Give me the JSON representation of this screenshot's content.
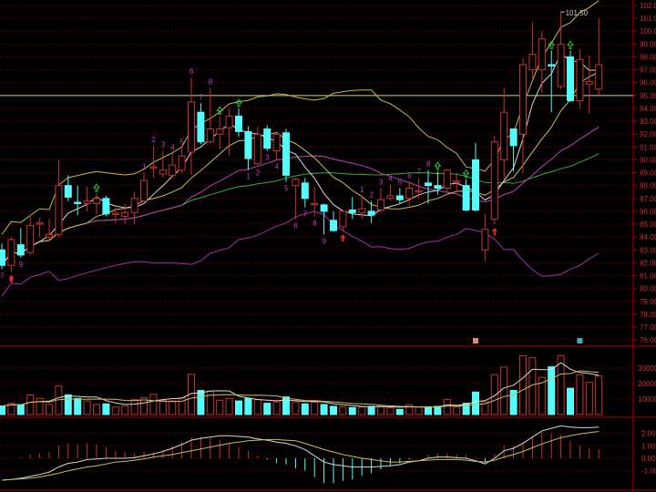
{
  "chart_data": {
    "type": "candlestick",
    "price_axis": {
      "ylim": [
        75.5,
        102.4
      ],
      "ticks": [
        "102.0",
        "101.0",
        "100.0",
        "99.00",
        "98.00",
        "97.00",
        "96.00",
        "95.00",
        "94.00",
        "93.00",
        "92.00",
        "91.00",
        "90.00",
        "89.00",
        "88.00",
        "87.00",
        "86.00",
        "85.00",
        "84.00",
        "83.00",
        "82.00",
        "81.00",
        "80.00",
        "79.00",
        "78.00",
        "77.00",
        "76.00"
      ]
    },
    "volume_axis": {
      "ylim": [
        0,
        45000
      ],
      "ticks": [
        "30000",
        "20000",
        "10000"
      ]
    },
    "macd_axis": {
      "ylim": [
        -3.7,
        3.3
      ],
      "ticks": [
        "2.00",
        "1.00",
        "0.00",
        "-1.00"
      ]
    },
    "reference_line": 95.0,
    "high_label": "101.50",
    "candles": [
      [
        83.0,
        83.5,
        81.5,
        81.8
      ],
      [
        81.8,
        84.0,
        81.3,
        83.8
      ],
      [
        83.4,
        84.7,
        82.4,
        82.6
      ],
      [
        82.8,
        85.7,
        82.6,
        84.9
      ],
      [
        85.0,
        85.5,
        84.0,
        85.1
      ],
      [
        84.0,
        85.4,
        83.8,
        84.2
      ],
      [
        84.2,
        90.0,
        84.0,
        88.0
      ],
      [
        88.0,
        88.8,
        86.8,
        87.1
      ],
      [
        86.7,
        88.0,
        85.7,
        86.6
      ],
      [
        86.6,
        87.9,
        86.0,
        86.8
      ],
      [
        86.6,
        87.4,
        85.8,
        87.0
      ],
      [
        87.0,
        87.2,
        85.6,
        85.8
      ],
      [
        85.75,
        86.3,
        85.1,
        85.85
      ],
      [
        85.6,
        86.6,
        85.0,
        85.9
      ],
      [
        85.9,
        87.5,
        85.0,
        87.0
      ],
      [
        86.8,
        89.0,
        86.6,
        88.4
      ],
      [
        89.35,
        91.1,
        88.6,
        89.45
      ],
      [
        88.9,
        90.7,
        88.6,
        89.2
      ],
      [
        88.8,
        90.5,
        88.6,
        89.6
      ],
      [
        89.2,
        90.9,
        89.0,
        90.3
      ],
      [
        90.6,
        96.4,
        88.8,
        94.5
      ],
      [
        93.7,
        94.4,
        91.2,
        91.4
      ],
      [
        91.4,
        95.6,
        91.2,
        92.4
      ],
      [
        92.0,
        93.4,
        90.8,
        92.4
      ],
      [
        92.5,
        94.0,
        90.3,
        93.4
      ],
      [
        93.4,
        94.0,
        91.8,
        92.2
      ],
      [
        92.2,
        92.6,
        89.2,
        90.1
      ],
      [
        89.7,
        92.6,
        89.5,
        92.0
      ],
      [
        92.4,
        92.7,
        90.7,
        90.9
      ],
      [
        90.7,
        92.2,
        90.0,
        92.0
      ],
      [
        92.1,
        92.4,
        88.3,
        88.8
      ],
      [
        88.0,
        88.6,
        85.4,
        88.5
      ],
      [
        88.2,
        88.6,
        86.3,
        87.0
      ],
      [
        86.5,
        87.9,
        85.6,
        86.6
      ],
      [
        86.5,
        86.6,
        84.2,
        86.0
      ],
      [
        85.3,
        86.0,
        84.4,
        84.5
      ],
      [
        84.8,
        86.1,
        84.5,
        86.0
      ],
      [
        86.1,
        87.1,
        85.4,
        85.9
      ],
      [
        85.9,
        87.2,
        85.4,
        86.2
      ],
      [
        86.0,
        86.8,
        85.1,
        85.7
      ],
      [
        86.1,
        87.8,
        85.9,
        86.9
      ],
      [
        87.0,
        88.1,
        86.8,
        87.2
      ],
      [
        87.2,
        87.8,
        86.6,
        86.9
      ],
      [
        87.0,
        88.3,
        86.4,
        87.8
      ],
      [
        87.5,
        88.6,
        87.0,
        87.6
      ],
      [
        88.2,
        89.2,
        86.6,
        88.0
      ],
      [
        88.0,
        89.1,
        87.3,
        87.8
      ],
      [
        87.8,
        89.3,
        87.5,
        89.2
      ],
      [
        88.25,
        89.0,
        87.5,
        88.35
      ],
      [
        88.0,
        88.5,
        86.0,
        86.1
      ],
      [
        90.0,
        91.3,
        86.0,
        86.1
      ],
      [
        83.0,
        85.8,
        82.1,
        84.6
      ],
      [
        85.4,
        91.9,
        85.0,
        91.4
      ],
      [
        90.0,
        95.6,
        88.4,
        93.7
      ],
      [
        92.4,
        92.4,
        89.1,
        91.1
      ],
      [
        92.0,
        97.9,
        89.0,
        97.4
      ],
      [
        97.0,
        100.7,
        96.2,
        98.2
      ],
      [
        97.0,
        100.0,
        95.2,
        99.4
      ],
      [
        97.4,
        98.5,
        93.7,
        97.3
      ],
      [
        95.7,
        101.5,
        95.5,
        99.0
      ],
      [
        98.0,
        98.5,
        94.5,
        94.6
      ],
      [
        94.6,
        98.6,
        94.0,
        97.8
      ],
      [
        95.9,
        98.1,
        93.6,
        96.1
      ],
      [
        95.5,
        101.0,
        95.0,
        97.4
      ]
    ],
    "volume": [
      5500,
      7200,
      6300,
      12700,
      10400,
      6500,
      18400,
      12700,
      10400,
      8800,
      6500,
      6900,
      4900,
      5500,
      9600,
      10800,
      13100,
      9200,
      8800,
      10800,
      26000,
      15600,
      15100,
      9200,
      10400,
      8800,
      10400,
      9600,
      7300,
      8200,
      11400,
      8200,
      6900,
      8000,
      6500,
      5300,
      4900,
      4500,
      4900,
      5300,
      5900,
      4300,
      3300,
      6300,
      4900,
      4900,
      5300,
      9800,
      4900,
      7300,
      14500,
      8200,
      25700,
      30600,
      15600,
      38000,
      36700,
      24000,
      30800,
      38000,
      17000,
      25700,
      20800,
      24900
    ],
    "macd_dif": [
      -1.75,
      -1.7,
      -1.6,
      -1.45,
      -1.3,
      -1.1,
      -0.7,
      -0.4,
      -0.3,
      -0.1,
      -0.05,
      0,
      0,
      0,
      0.05,
      0.2,
      0.35,
      0.55,
      0.8,
      1.1,
      1.45,
      1.6,
      1.7,
      1.8,
      1.8,
      1.75,
      1.7,
      1.55,
      1.45,
      1.3,
      1.2,
      1.0,
      0.7,
      0.2,
      -0.3,
      -0.5,
      -0.6,
      -0.7,
      -0.7,
      -0.7,
      -0.65,
      -0.6,
      -0.5,
      -0.3,
      -0.2,
      0,
      0.1,
      0.1,
      0.05,
      0,
      -0.2,
      -0.45,
      0,
      0.6,
      0.8,
      1.2,
      1.7,
      2.2,
      2.4,
      2.6,
      2.5,
      2.45,
      2.45,
      2.5
    ],
    "macd_dea": [
      -1.75,
      -1.7,
      -1.65,
      -1.6,
      -1.5,
      -1.35,
      -1.2,
      -1.0,
      -0.85,
      -0.7,
      -0.6,
      -0.45,
      -0.3,
      -0.25,
      -0.15,
      -0.05,
      0.1,
      0.2,
      0.3,
      0.45,
      0.6,
      0.75,
      0.9,
      1.05,
      1.2,
      1.3,
      1.4,
      1.45,
      1.5,
      1.5,
      1.45,
      1.4,
      1.2,
      0.95,
      0.7,
      0.5,
      0.3,
      0.15,
      0,
      -0.1,
      -0.2,
      -0.3,
      -0.3,
      -0.25,
      -0.2,
      -0.15,
      -0.1,
      -0.1,
      -0.1,
      -0.15,
      -0.25,
      -0.3,
      -0.15,
      0.1,
      0.3,
      0.55,
      0.85,
      1.15,
      1.4,
      1.65,
      1.8,
      1.95,
      2.05,
      2.15
    ],
    "sequence_labels": [
      {
        "i": 0,
        "text": "7",
        "pos": "below"
      },
      {
        "i": 1,
        "text": "8",
        "pos": "below"
      },
      {
        "i": 2,
        "text": "9",
        "pos": "below"
      },
      {
        "i": 15,
        "text": "1",
        "pos": "above"
      },
      {
        "i": 16,
        "text": "2",
        "pos": "above"
      },
      {
        "i": 17,
        "text": "3",
        "pos": "above"
      },
      {
        "i": 18,
        "text": "4",
        "pos": "above"
      },
      {
        "i": 19,
        "text": "5",
        "pos": "above"
      },
      {
        "i": 20,
        "text": "6",
        "pos": "above"
      },
      {
        "i": 21,
        "text": "7",
        "pos": "above"
      },
      {
        "i": 22,
        "text": "8",
        "pos": "above"
      },
      {
        "i": 26,
        "text": "1",
        "pos": "below"
      },
      {
        "i": 27,
        "text": "2",
        "pos": "below"
      },
      {
        "i": 28,
        "text": "3",
        "pos": "below"
      },
      {
        "i": 29,
        "text": "4",
        "pos": "below"
      },
      {
        "i": 30,
        "text": "5",
        "pos": "below"
      },
      {
        "i": 31,
        "text": "6",
        "pos": "below"
      },
      {
        "i": 32,
        "text": "7",
        "pos": "below"
      },
      {
        "i": 33,
        "text": "8",
        "pos": "below"
      },
      {
        "i": 34,
        "text": "9",
        "pos": "below"
      },
      {
        "i": 38,
        "text": "1",
        "pos": "above"
      },
      {
        "i": 39,
        "text": "2",
        "pos": "above"
      },
      {
        "i": 40,
        "text": "3",
        "pos": "above"
      },
      {
        "i": 41,
        "text": "4",
        "pos": "above"
      },
      {
        "i": 42,
        "text": "5",
        "pos": "above"
      },
      {
        "i": 43,
        "text": "6",
        "pos": "above"
      },
      {
        "i": 44,
        "text": "7",
        "pos": "above"
      },
      {
        "i": 45,
        "text": "8",
        "pos": "above"
      }
    ],
    "arrows": [
      {
        "i": 1,
        "type": "buy"
      },
      {
        "i": 10,
        "type": "sell"
      },
      {
        "i": 23,
        "type": "sell"
      },
      {
        "i": 25,
        "type": "sell"
      },
      {
        "i": 36,
        "type": "buy"
      },
      {
        "i": 46,
        "type": "sell"
      },
      {
        "i": 49,
        "type": "sell"
      },
      {
        "i": 52,
        "type": "buy"
      },
      {
        "i": 58,
        "type": "sell"
      },
      {
        "i": 60,
        "type": "sell"
      }
    ],
    "event_markers": [
      {
        "i": 50,
        "color": "#d89070"
      },
      {
        "i": 61,
        "color": "#40b0b0"
      }
    ],
    "colors": {
      "up": "#c83232",
      "down": "#54fcfc",
      "axis": "#b00000",
      "grid": "#5a0000",
      "ma5": "#d8d8d8",
      "ma10": "#c8c050",
      "ma20": "#c040c0",
      "ma30": "#30b030",
      "boll": "#c8b840",
      "boll_low": "#a030b0",
      "ref": "#d8d070",
      "dif": "#d8d8d8",
      "dea": "#c8c050"
    }
  }
}
